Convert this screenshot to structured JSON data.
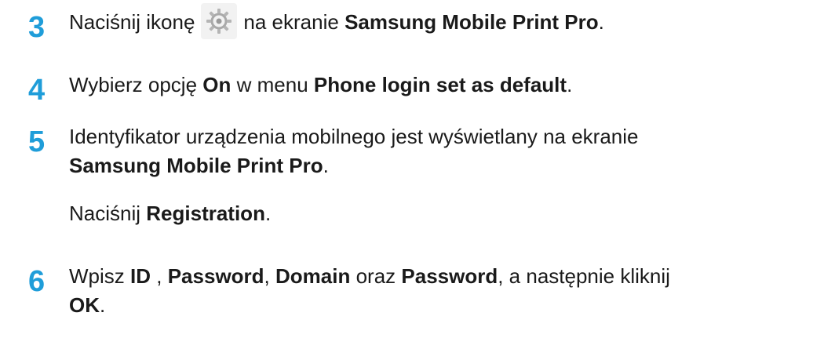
{
  "accent_color": "#1f9dd9",
  "steps": [
    {
      "number": "3",
      "t1": "Naciśnij ikonę",
      "t2": "na ekranie",
      "b1": "Samsung Mobile Print Pro",
      "t3": ".",
      "icon": "gear-icon"
    },
    {
      "number": "4",
      "t1": "Wybierz opcję",
      "b1": "On",
      "t2": "w menu",
      "b2": "Phone login set as default",
      "t3": "."
    },
    {
      "number": "5",
      "t1": "Identyfikator urządzenia mobilnego jest wyświetlany na ekranie",
      "b1": "Samsung Mobile Print Pro",
      "t2": ".",
      "sub_t1": "Naciśnij",
      "sub_b1": "Registration",
      "sub_t2": "."
    },
    {
      "number": "6",
      "t1": "Wpisz",
      "b1": "ID",
      "t2": ",",
      "b2": "Password",
      "t3": ",",
      "b3": "Domain",
      "t4": "oraz",
      "b4": "Password",
      "t5": ", a następnie kliknij",
      "b5": "OK",
      "t6": "."
    }
  ]
}
